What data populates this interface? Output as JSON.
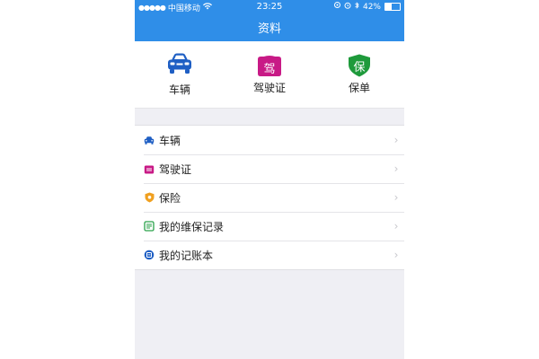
{
  "status_bar": {
    "carrier": "中国移动",
    "time": "23:25",
    "battery": "42%"
  },
  "nav": {
    "title": "资料"
  },
  "top_grid": [
    {
      "label": "车辆",
      "icon": "car-icon",
      "color": "#1f5fc4"
    },
    {
      "label": "驾驶证",
      "icon": "license-icon",
      "glyph": "驾",
      "color": "#c81a86"
    },
    {
      "label": "保单",
      "icon": "shield-icon",
      "glyph": "保",
      "color": "#1e9a3b"
    }
  ],
  "list": [
    {
      "label": "车辆",
      "icon": "car-icon",
      "color": "#1f5fc4"
    },
    {
      "label": "驾驶证",
      "icon": "license-icon",
      "color": "#c81a86"
    },
    {
      "label": "保险",
      "icon": "insurance-icon",
      "color": "#f0a020"
    },
    {
      "label": "我的维保记录",
      "icon": "maintenance-record-icon",
      "color": "#2aa24a"
    },
    {
      "label": "我的记账本",
      "icon": "ledger-icon",
      "color": "#1f5fc4"
    }
  ],
  "colors": {
    "accent": "#2f8ee8",
    "background": "#efeff4"
  }
}
